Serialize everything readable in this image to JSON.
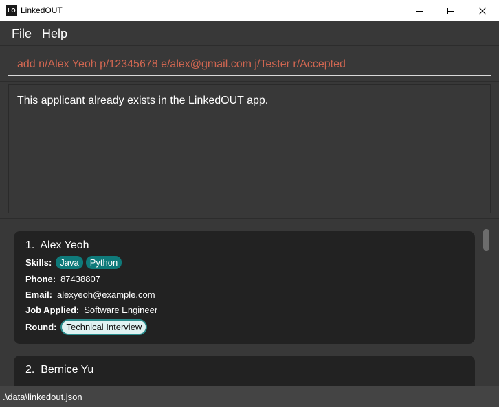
{
  "window": {
    "app_icon_text": "LO",
    "title": "LinkedOUT"
  },
  "menu": {
    "file": "File",
    "help": "Help"
  },
  "command": {
    "value": "add n/Alex Yeoh p/12345678 e/alex@gmail.com j/Tester r/Accepted",
    "text_color": "#d06651"
  },
  "result": {
    "message": "This applicant already exists in the LinkedOUT app."
  },
  "labels": {
    "skills": "Skills:",
    "phone": "Phone:",
    "email": "Email:",
    "job": "Job Applied:",
    "round": "Round:"
  },
  "applicants": [
    {
      "index": "1.",
      "name": "Alex Yeoh",
      "skills": [
        "Java",
        "Python"
      ],
      "phone": "87438807",
      "email": "alexyeoh@example.com",
      "job": "Software Engineer",
      "round": "Technical Interview"
    },
    {
      "index": "2.",
      "name": "Bernice Yu"
    }
  ],
  "status": {
    "path": ".\\data\\linkedout.json"
  },
  "colors": {
    "background": "#383838",
    "card": "#222222",
    "skill_tag": "#0f7a7a",
    "round_tag": "#e0f2f2",
    "round_border": "#2a8d8d"
  }
}
